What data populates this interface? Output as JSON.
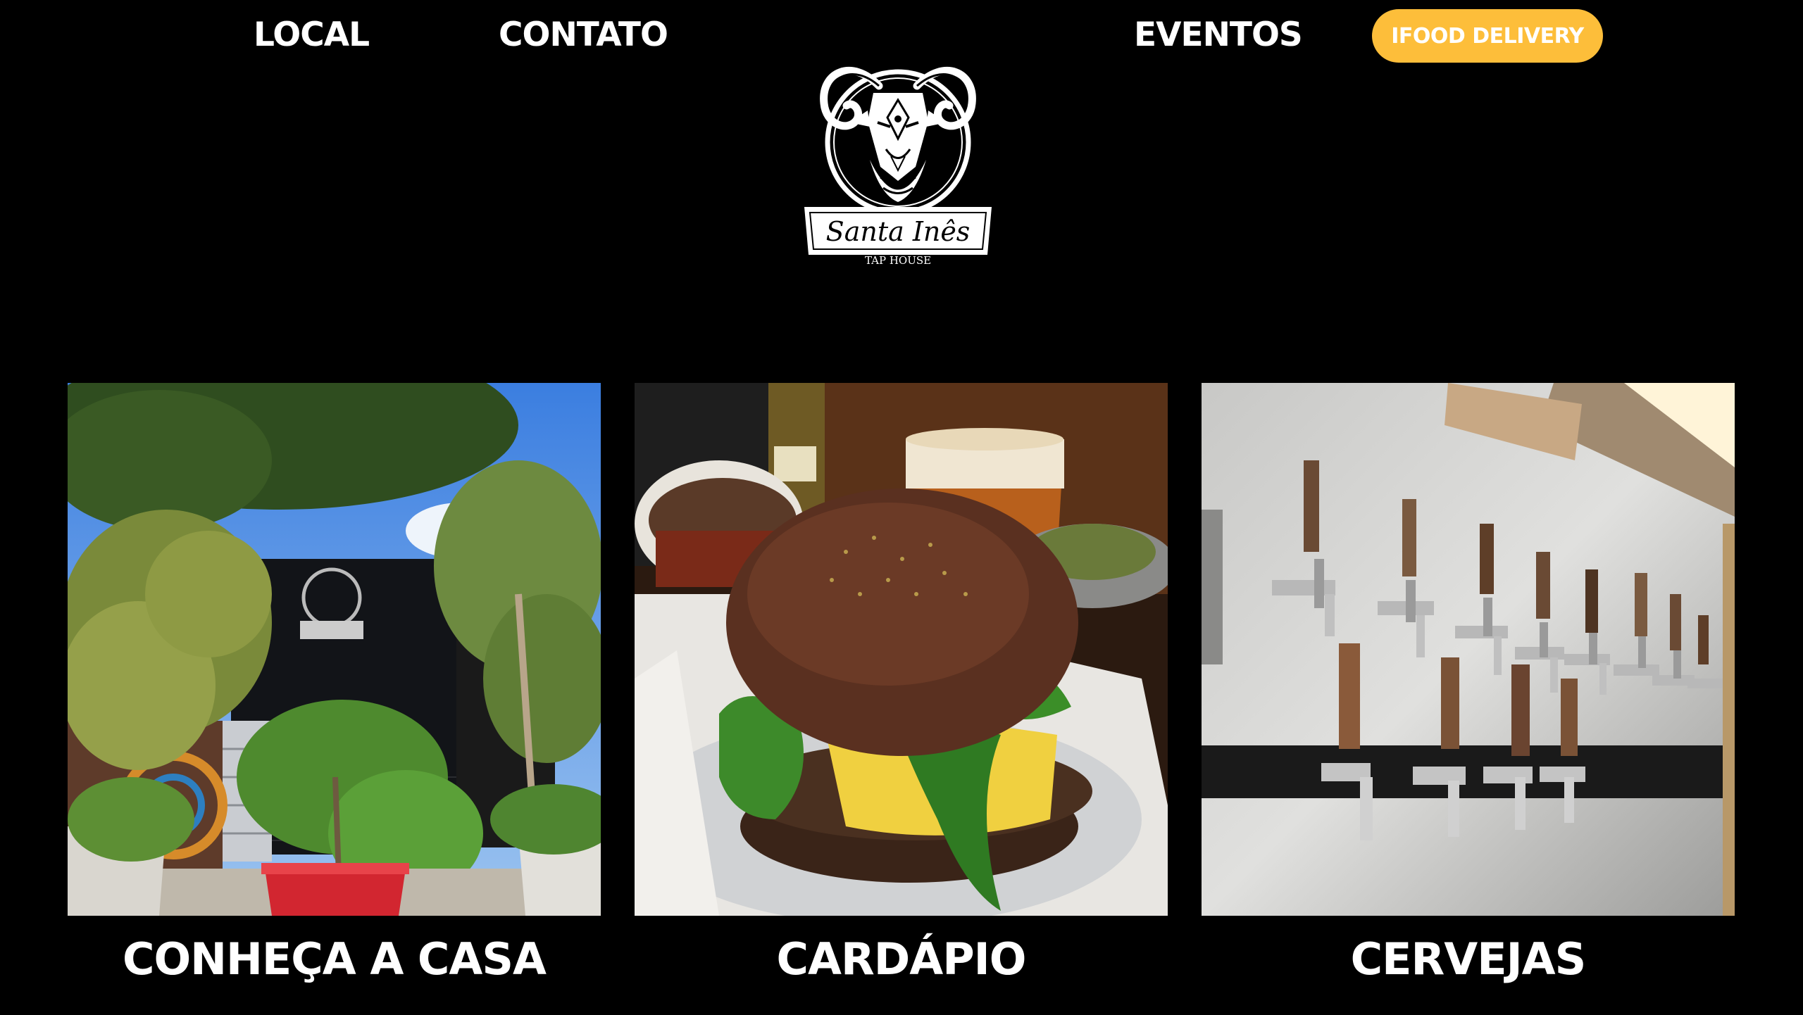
{
  "nav": {
    "local": "LOCAL",
    "contato": "CONTATO",
    "eventos": "EVENTOS",
    "ifood": "IFOOD DELIVERY"
  },
  "logo": {
    "name": "Santa Inês",
    "tagline": "TAP HOUSE",
    "icon": "ram-head-logo"
  },
  "cards": [
    {
      "title": "CONHEÇA A CASA",
      "image": "storefront-photo"
    },
    {
      "title": "CARDÁPIO",
      "image": "burger-photo"
    },
    {
      "title": "CERVEJAS",
      "image": "beer-taps-photo"
    }
  ],
  "colors": {
    "background": "#000000",
    "text": "#ffffff",
    "accent": "#FDBE3A"
  }
}
